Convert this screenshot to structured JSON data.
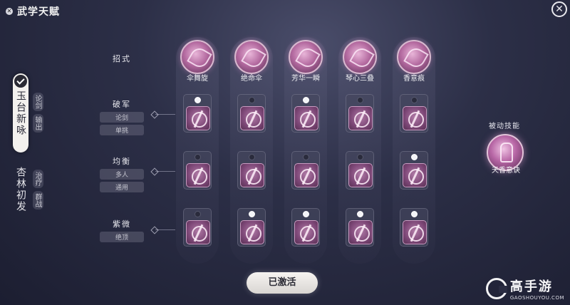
{
  "window": {
    "title": "武学天赋",
    "close_symbol": "✕"
  },
  "paths": [
    {
      "name": "玉台新咏",
      "tags": [
        "论剑",
        "输出"
      ],
      "active": true
    },
    {
      "name": "杏林初发",
      "tags": [
        "治疗",
        "群战"
      ],
      "active": false
    }
  ],
  "rows": {
    "moves": {
      "label": "招式"
    },
    "pojun": {
      "label": "破军",
      "tags": [
        "论剑",
        "单挑"
      ]
    },
    "junheng": {
      "label": "均衡",
      "tags": [
        "多人",
        "通用"
      ]
    },
    "ziwei": {
      "label": "紫微",
      "tags": [
        "绝顶"
      ]
    }
  },
  "skills": [
    {
      "name": "伞舞旋",
      "selected": [
        "pojun"
      ]
    },
    {
      "name": "绝命伞",
      "selected": [
        "ziwei"
      ]
    },
    {
      "name": "芳华一瞬",
      "selected": [
        "pojun",
        "ziwei"
      ]
    },
    {
      "name": "琴心三叠",
      "selected": [
        "ziwei"
      ]
    },
    {
      "name": "香意痕",
      "selected": [
        "junheng",
        "ziwei"
      ]
    }
  ],
  "passive": {
    "label": "被动技能",
    "name": "天香意诀"
  },
  "activate_button": {
    "label": "已激活"
  },
  "watermark": {
    "brand": "高手游",
    "url": "GAOSHOUYOU.COM"
  },
  "colors": {
    "accent": "#b46aa0",
    "background": "#2c2f47",
    "button": "#f6f4f1"
  }
}
